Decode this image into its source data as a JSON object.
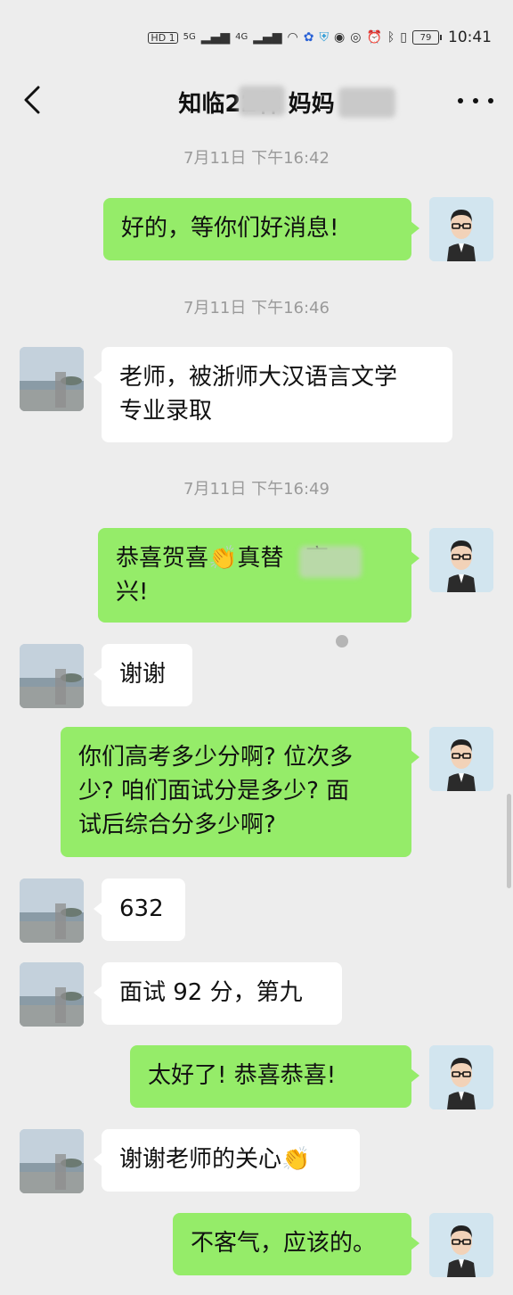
{
  "status_bar": {
    "network_left": "HD 1",
    "signal_1": "5G",
    "signal_2": "4G",
    "battery": "79",
    "time": "10:41"
  },
  "nav": {
    "title": "知临22林  妈妈",
    "back_icon": "chevron-left-icon",
    "more_icon": "more-dots-icon"
  },
  "messages": [
    {
      "type": "timestamp",
      "text": "7月11日 下午16:42"
    },
    {
      "type": "me",
      "text": "好的，等你们好消息!"
    },
    {
      "type": "timestamp",
      "text": "7月11日 下午16:46"
    },
    {
      "type": "other",
      "text": "老师，被浙师大汉语言文学\n专业录取"
    },
    {
      "type": "timestamp",
      "text": "7月11日 下午16:49"
    },
    {
      "type": "me",
      "text": "恭喜贺喜👏真替   高\n兴!"
    },
    {
      "type": "other",
      "text": "谢谢"
    },
    {
      "type": "me",
      "text": "你们高考多少分啊? 位次多\n少? 咱们面试分是多少? 面\n试后综合分多少啊?"
    },
    {
      "type": "other",
      "text": "632"
    },
    {
      "type": "other",
      "text": "面试 92 分，第九"
    },
    {
      "type": "me",
      "text": "太好了! 恭喜恭喜!"
    },
    {
      "type": "other",
      "text": "谢谢老师的关心👏"
    },
    {
      "type": "me",
      "text": "不客气，应该的。"
    }
  ],
  "colors": {
    "background": "#ededed",
    "bubble_me": "#95ec69",
    "bubble_other": "#ffffff",
    "timestamp_text": "#9a9a9a"
  }
}
